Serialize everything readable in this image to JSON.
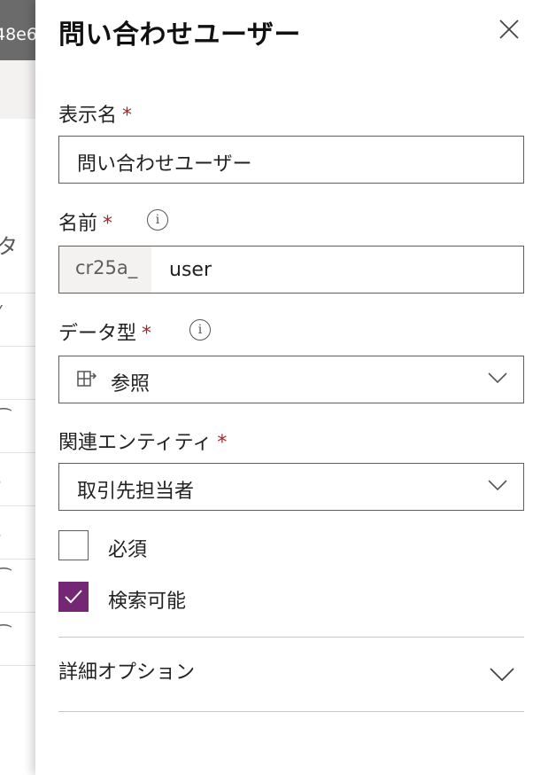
{
  "background": {
    "topbar_fragment": "48e6",
    "side_fragment": "タ",
    "row_glyphs": [
      "⁄",
      "⁀",
      "·",
      "·",
      "⁀",
      "⁀"
    ]
  },
  "panel": {
    "title": "問い合わせユーザー",
    "display_name": {
      "label": "表示名",
      "required": "*",
      "value": "問い合わせユーザー"
    },
    "name": {
      "label": "名前",
      "required": "*",
      "info": "i",
      "prefix": "cr25a_",
      "value": "user"
    },
    "data_type": {
      "label": "データ型",
      "required": "*",
      "info": "i",
      "icon": "lookup-icon",
      "value": "参照"
    },
    "related_entity": {
      "label": "関連エンティティ",
      "required": "*",
      "value": "取引先担当者"
    },
    "required_checkbox": {
      "label": "必須",
      "checked": false
    },
    "searchable_checkbox": {
      "label": "検索可能",
      "checked": true
    },
    "advanced_options": {
      "label": "詳細オプション"
    },
    "colors": {
      "accent": "#742774",
      "required_star": "#a4262c",
      "border": "#605e5c"
    }
  }
}
